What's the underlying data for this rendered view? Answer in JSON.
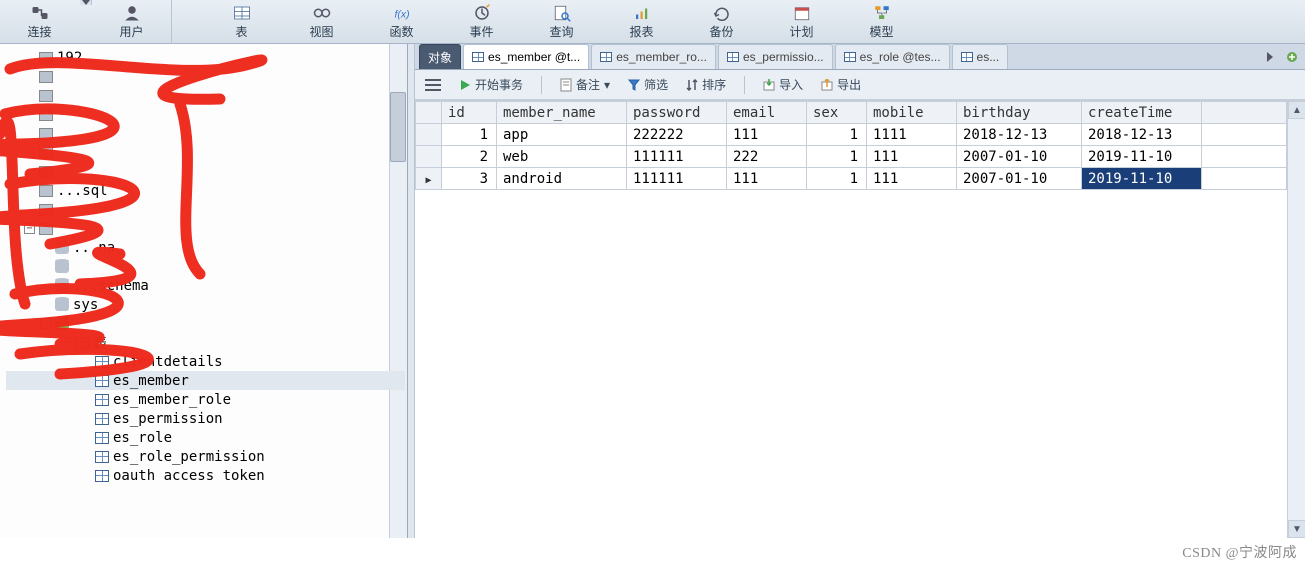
{
  "toolbar": {
    "connect": "连接",
    "user": "用户",
    "table": "表",
    "view": "视图",
    "function": "函数",
    "event": "事件",
    "query": "查询",
    "report": "报表",
    "backup": "备份",
    "plan": "计划",
    "model": "模型"
  },
  "tree": {
    "sys": "sys",
    "table_node": "表",
    "tables": [
      "clientdetails",
      "es_member",
      "es_member_role",
      "es_permission",
      "es_role",
      "es_role_permission",
      "oauth access token"
    ],
    "obscured_hints": [
      "192.",
      "...sql",
      "...na",
      "...schema"
    ],
    "selected": "es_member"
  },
  "tabs": {
    "object": "对象",
    "items": [
      "es_member @t...",
      "es_member_ro...",
      "es_permissio...",
      "es_role @tes...",
      "es..."
    ]
  },
  "subtoolbar": {
    "begin_tx": "开始事务",
    "note": "备注",
    "filter": "筛选",
    "sort": "排序",
    "import": "导入",
    "export": "导出"
  },
  "grid": {
    "columns": [
      "id",
      "member_name",
      "password",
      "email",
      "sex",
      "mobile",
      "birthday",
      "createTime"
    ],
    "rows": [
      {
        "id": "1",
        "member_name": "app",
        "password": "222222",
        "email": "111",
        "sex": "1",
        "mobile": "1111",
        "birthday": "2018-12-13",
        "createTime": "2018-12-13"
      },
      {
        "id": "2",
        "member_name": "web",
        "password": "111111",
        "email": "222",
        "sex": "1",
        "mobile": "111",
        "birthday": "2007-01-10",
        "createTime": "2019-11-10"
      },
      {
        "id": "3",
        "member_name": "android",
        "password": "111111",
        "email": "111",
        "sex": "1",
        "mobile": "111",
        "birthday": "2007-01-10",
        "createTime": "2019-11-10"
      }
    ],
    "active_row_index": 2,
    "selected_cell": {
      "row": 2,
      "col": "createTime"
    }
  },
  "watermark": "CSDN @宁波阿成"
}
